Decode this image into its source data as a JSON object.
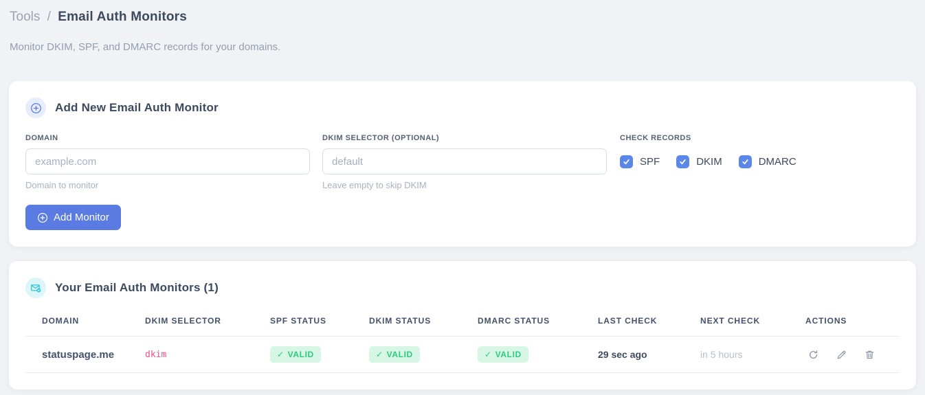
{
  "page": {
    "breadcrumb_section": "Tools",
    "breadcrumb_separator": "/",
    "title": "Email Auth Monitors",
    "subtitle": "Monitor DKIM, SPF, and DMARC records for your domains."
  },
  "add_monitor_card": {
    "title": "Add New Email Auth Monitor",
    "fields": {
      "domain": {
        "label": "DOMAIN",
        "placeholder": "example.com",
        "value": "",
        "helper": "Domain to monitor"
      },
      "dkim_selector": {
        "label": "DKIM SELECTOR (OPTIONAL)",
        "placeholder": "default",
        "value": "",
        "helper": "Leave empty to skip DKIM"
      }
    },
    "check_records": {
      "label": "CHECK RECORDS",
      "options": [
        {
          "label": "SPF",
          "checked": true
        },
        {
          "label": "DKIM",
          "checked": true
        },
        {
          "label": "DMARC",
          "checked": true
        }
      ]
    },
    "submit_label": "Add Monitor"
  },
  "monitors_card": {
    "title": "Your Email Auth Monitors (1)",
    "count": 1,
    "table": {
      "columns": [
        "DOMAIN",
        "DKIM SELECTOR",
        "SPF STATUS",
        "DKIM STATUS",
        "DMARC STATUS",
        "LAST CHECK",
        "NEXT CHECK",
        "ACTIONS"
      ],
      "rows": [
        {
          "domain": "statuspage.me",
          "dkim_selector": "dkim",
          "spf_status": "VALID",
          "dkim_status": "VALID",
          "dmarc_status": "VALID",
          "status_check_glyph": "✓",
          "last_check": "29 sec ago",
          "next_check": "in 5 hours",
          "actions": [
            "refresh",
            "edit",
            "delete"
          ]
        }
      ]
    }
  },
  "colors": {
    "accent_blue": "#5a7ce2",
    "checkbox_blue": "#5b87e8",
    "badge_green_bg": "#d8f6e5",
    "badge_green_text": "#2dcb81",
    "code_pink": "#ea5288",
    "icon_teal": "#2bc3d8",
    "page_background": "#f1f2f5"
  }
}
